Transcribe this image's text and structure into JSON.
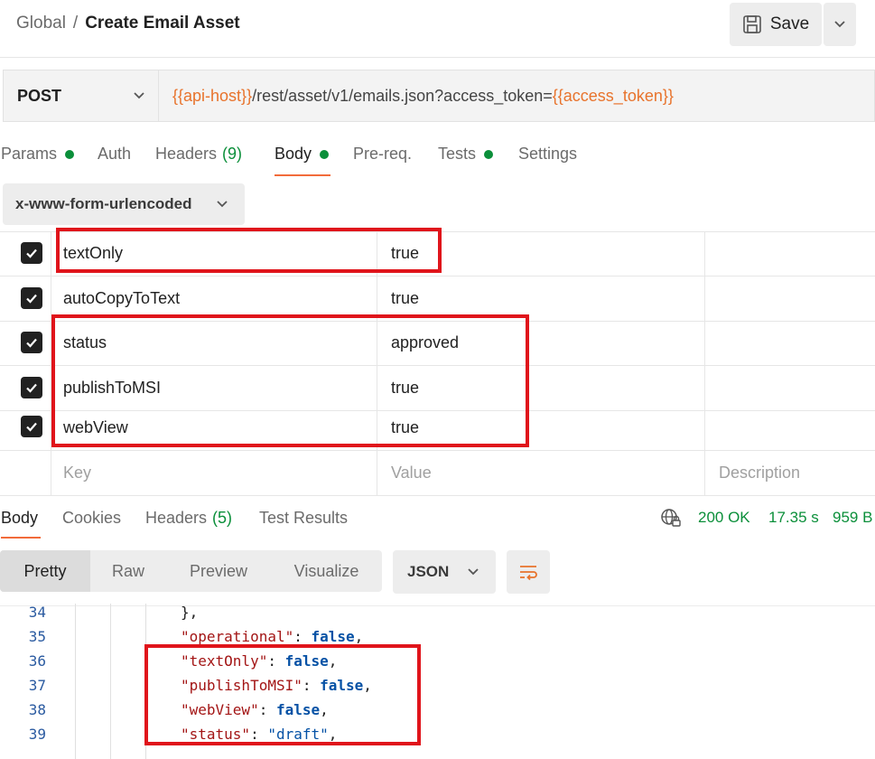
{
  "header": {
    "breadcrumb_parent": "Global",
    "breadcrumb_sep": "/",
    "title": "Create Email Asset",
    "save_label": "Save"
  },
  "request": {
    "method": "POST",
    "url_parts": [
      "{{api-host}}",
      "/rest/asset/v1/emails.json?access_token=",
      "{{access_token}}"
    ]
  },
  "request_tabs": [
    {
      "label": "Params",
      "dot": true
    },
    {
      "label": "Auth"
    },
    {
      "label": "Headers",
      "count": "(9)"
    },
    {
      "label": "Body",
      "dot": true,
      "active": true
    },
    {
      "label": "Pre-req."
    },
    {
      "label": "Tests",
      "dot": true
    },
    {
      "label": "Settings"
    }
  ],
  "body_type": "x-www-form-urlencoded",
  "params": [
    {
      "key": "textOnly",
      "value": "true",
      "checked": true
    },
    {
      "key": "autoCopyToText",
      "value": "true",
      "checked": true
    },
    {
      "key": "status",
      "value": "approved",
      "checked": true
    },
    {
      "key": "publishToMSI",
      "value": "true",
      "checked": true
    },
    {
      "key": "webView",
      "value": "true",
      "checked": true
    }
  ],
  "params_placeholder": {
    "key": "Key",
    "value": "Value",
    "description": "Description"
  },
  "response_tabs": [
    {
      "label": "Body",
      "active": true
    },
    {
      "label": "Cookies"
    },
    {
      "label": "Headers",
      "count": "(5)"
    },
    {
      "label": "Test Results"
    }
  ],
  "response_status": {
    "code": "200 OK",
    "time": "17.35 s",
    "size": "959 B"
  },
  "view_modes": [
    "Pretty",
    "Raw",
    "Preview",
    "Visualize"
  ],
  "format": "JSON",
  "code_lines": [
    {
      "num": "34",
      "text": "},"
    },
    {
      "num": "35",
      "key": "\"operational\"",
      "val": "false",
      "type": "bool"
    },
    {
      "num": "36",
      "key": "\"textOnly\"",
      "val": "false",
      "type": "bool"
    },
    {
      "num": "37",
      "key": "\"publishToMSI\"",
      "val": "false",
      "type": "bool"
    },
    {
      "num": "38",
      "key": "\"webView\"",
      "val": "false",
      "type": "bool"
    },
    {
      "num": "39",
      "key": "\"status\"",
      "val": "\"draft\"",
      "type": "str"
    }
  ],
  "colors": {
    "accent": "#f26b3a",
    "success": "#0b8f3a",
    "variable": "#e8732c",
    "highlight": "#e0141b"
  }
}
